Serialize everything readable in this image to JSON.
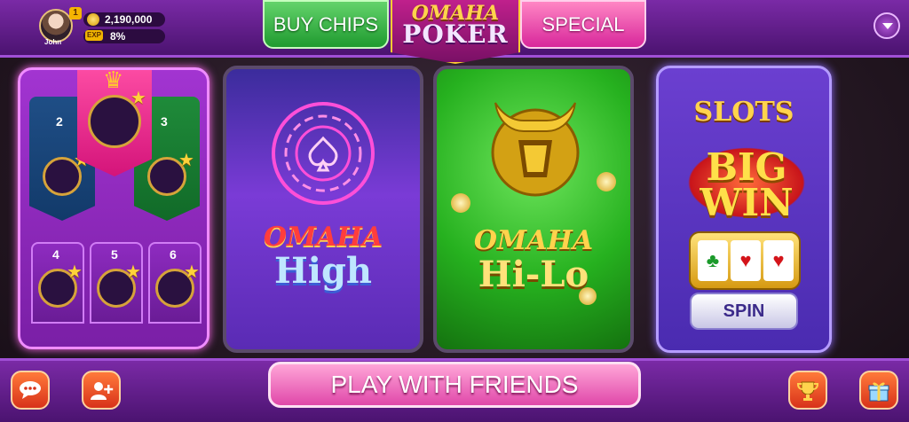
{
  "player": {
    "name": "John",
    "vip_level": "1",
    "chips": "2,190,000",
    "exp_label": "EXP",
    "exp_percent": "8%"
  },
  "header": {
    "buy_chips": "BUY CHIPS",
    "logo_line1": "OMAHA",
    "logo_line2": "POKER",
    "special": "SPECIAL"
  },
  "sit_and_go": {
    "seats": [
      "2",
      "3",
      "4",
      "5",
      "6"
    ]
  },
  "games": {
    "high": {
      "line1": "OMAHA",
      "line2": "High"
    },
    "hilo": {
      "line1": "OMAHA",
      "line2": "Hi-Lo"
    },
    "slots": {
      "title": "SLOTS",
      "banner": "BIG WIN",
      "button": "SPIN"
    }
  },
  "footer": {
    "play_with_friends": "PLAY WITH FRIENDS"
  },
  "icons": {
    "chat": "chat-icon",
    "friends": "add-friend-icon",
    "trophy": "trophy-icon",
    "gift": "gift-icon",
    "menu": "chevron-down-icon",
    "coin": "coin-icon",
    "crown": "crown-icon"
  },
  "colors": {
    "buy_chips": "#3bb84a",
    "special": "#e94bb0",
    "hilo_card": "#26b11f",
    "high_card": "#7a3bd6",
    "play_button": "#f07cc3"
  }
}
